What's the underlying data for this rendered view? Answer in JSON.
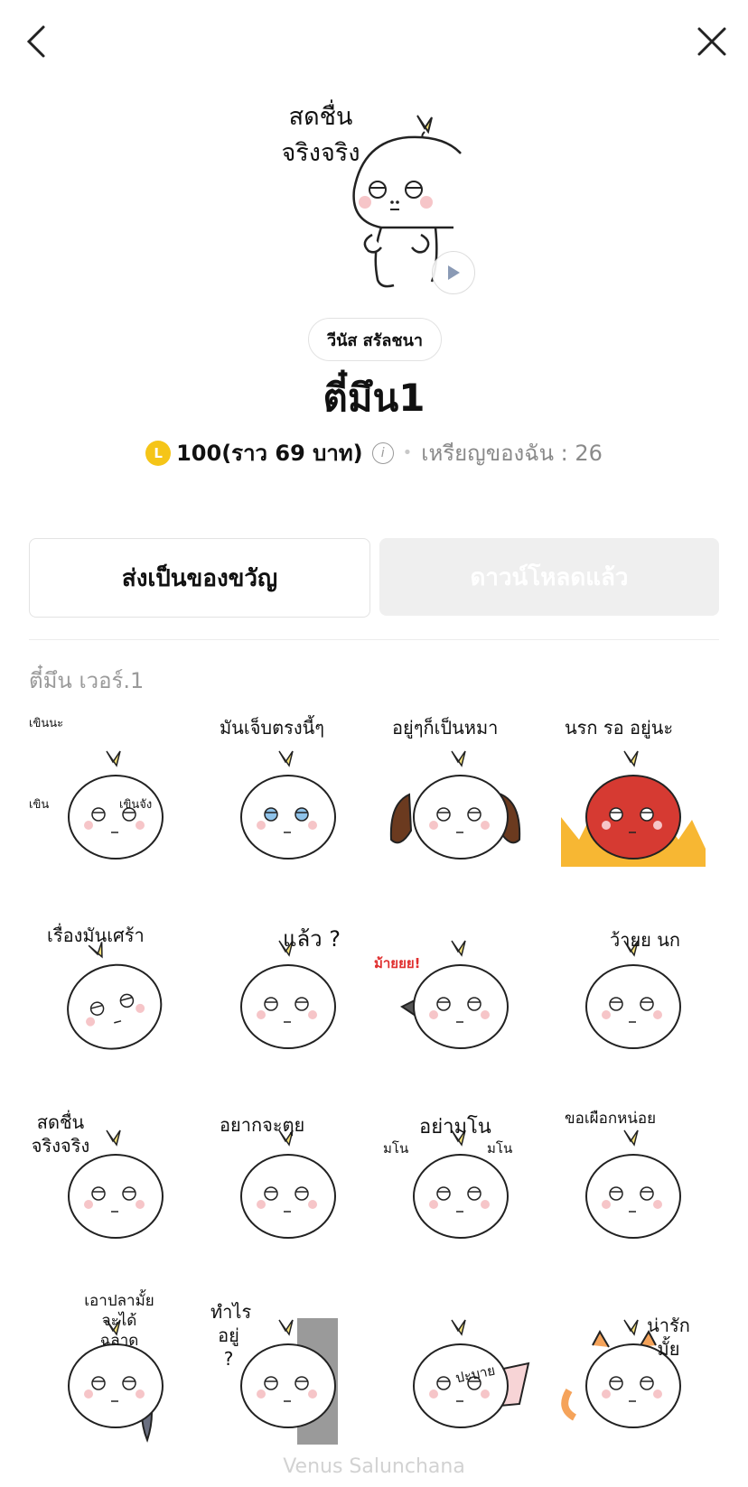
{
  "header": {
    "back_icon": "chevron-left-icon",
    "close_icon": "close-icon"
  },
  "hero": {
    "caption_line1": "สดชื่น",
    "caption_line2": "จริงจริง"
  },
  "author": "วีนัส สรัลชนา",
  "title": "ตี๋มึน1",
  "price": {
    "coin_glyph": "L",
    "amount": "100(ราว 69 บาท)",
    "my_coins": "เหรียญของฉัน : 26"
  },
  "buttons": {
    "gift": "ส่งเป็นของขวัญ",
    "download": "ดาวน์โหลดแล้ว"
  },
  "section_title": "ตี๋มึน เวอร์.1",
  "stickers": [
    {
      "caption": "เขินนะ",
      "extra1": "เขิน",
      "extra2": "เขินจัง"
    },
    {
      "caption": "มันเจ็บตรงนี้ๆ"
    },
    {
      "caption": "อยู่ๆก็เป็นหมา"
    },
    {
      "caption": "นรก รอ อยู่นะ"
    },
    {
      "caption": "เรื่องมันเศร้า"
    },
    {
      "caption": "แล้ว ?"
    },
    {
      "caption": "ม้ายยย!"
    },
    {
      "caption": "ว้ายย นก"
    },
    {
      "caption": "สดชื่น จริงจริง"
    },
    {
      "caption": "อยากจะตุย"
    },
    {
      "caption": "อย่ามโน",
      "extra1": "มโน",
      "extra2": "มโน"
    },
    {
      "caption": "ขอเผือกหน่อย"
    },
    {
      "caption": "เอาปลามั้ย จะได้ ฉลาด"
    },
    {
      "caption": "ทำไร อยู่ ?"
    },
    {
      "caption": "ปะบาย"
    },
    {
      "caption": "น่ารัก มั้ย"
    }
  ],
  "footer": "Venus Salunchana",
  "colors": {
    "coin": "#f5c518",
    "leaf": "#f3e07a",
    "blush": "#f6c5c8",
    "muted": "#9a9a9a"
  }
}
